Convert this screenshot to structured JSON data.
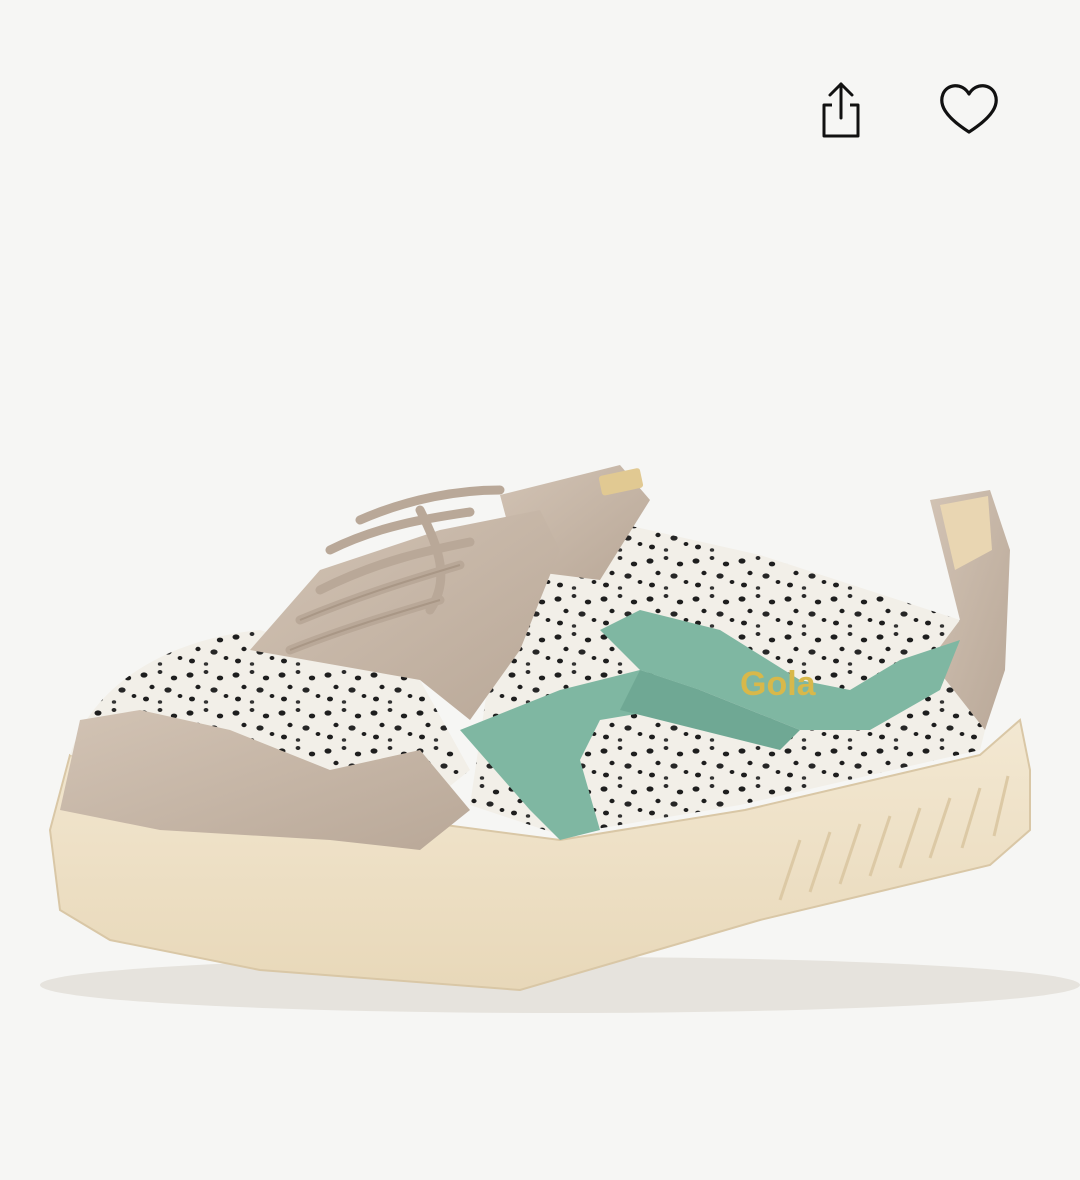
{
  "toolbar": {
    "share_icon": "share-icon",
    "favorite_icon": "heart-icon"
  },
  "product_image": {
    "brand_logo_text": "Gola",
    "colors": {
      "background": "#f6f6f4",
      "suede": "#c9b8a8",
      "sole": "#efe2c8",
      "stripe": "#7fb7a2",
      "logo": "#d8b84a",
      "spots": "#1e1e1e"
    }
  }
}
